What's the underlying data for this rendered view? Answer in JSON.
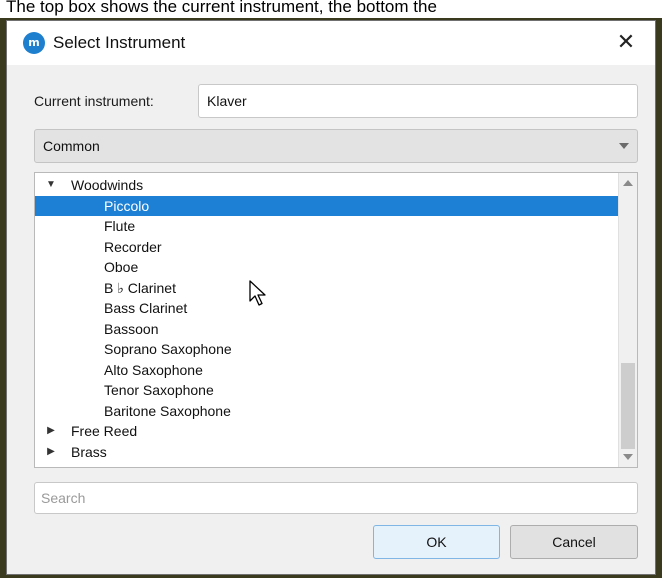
{
  "caption": "The top box shows the current instrument, the bottom the",
  "window": {
    "title": "Select Instrument",
    "app_icon_label": "m",
    "close_glyph": "✕"
  },
  "current_instrument": {
    "label": "Current instrument:",
    "value": "Klaver"
  },
  "group_select": {
    "selected": "Common"
  },
  "tree": {
    "groups": [
      {
        "label": "Woodwinds",
        "expanded": true,
        "items": [
          {
            "label": "Piccolo",
            "selected": true
          },
          {
            "label": "Flute"
          },
          {
            "label": "Recorder"
          },
          {
            "label": "Oboe"
          },
          {
            "label": "B ♭ Clarinet"
          },
          {
            "label": "Bass Clarinet"
          },
          {
            "label": "Bassoon"
          },
          {
            "label": "Soprano Saxophone"
          },
          {
            "label": "Alto Saxophone"
          },
          {
            "label": "Tenor Saxophone"
          },
          {
            "label": "Baritone Saxophone"
          }
        ]
      },
      {
        "label": "Free Reed",
        "expanded": false,
        "items": []
      },
      {
        "label": "Brass",
        "expanded": false,
        "items": []
      }
    ]
  },
  "search": {
    "placeholder": "Search"
  },
  "buttons": {
    "ok": "OK",
    "cancel": "Cancel"
  },
  "colors": {
    "selection": "#1e80d4",
    "ok_button_border": "#7fb6e6"
  }
}
